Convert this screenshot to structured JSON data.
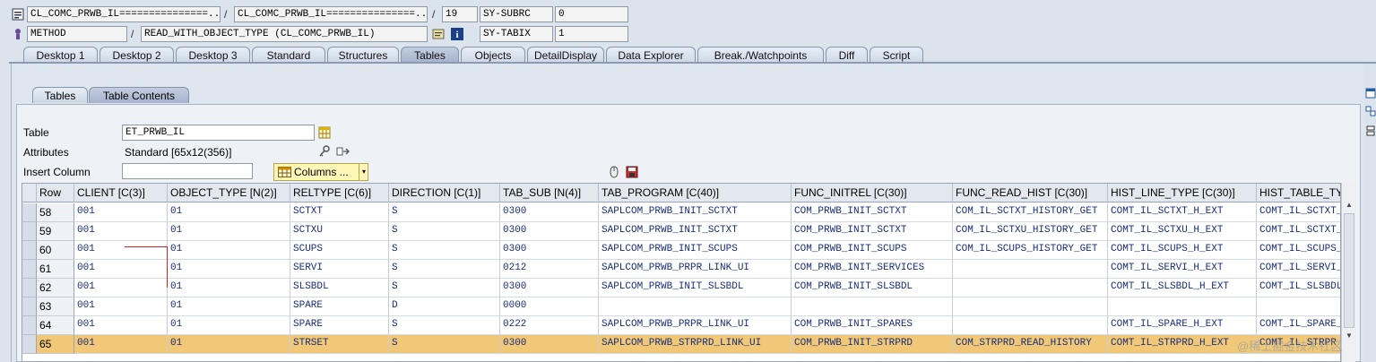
{
  "top": {
    "row1": {
      "class_field": "CL_COMC_PRWB_IL===============...",
      "sep1": "/",
      "include_field": "CL_COMC_PRWB_IL===============...",
      "sep2": "/",
      "line_field": "19",
      "sysvar_name": "SY-SUBRC",
      "sysvar_value": "0"
    },
    "row2": {
      "type_field": "METHOD",
      "sep1": "/",
      "method_field": "READ_WITH_OBJECT_TYPE (CL_COMC_PRWB_IL)",
      "sysvar_name": "SY-TABIX",
      "sysvar_value": "1"
    }
  },
  "tabs": [
    "Desktop 1",
    "Desktop 2",
    "Desktop 3",
    "Standard",
    "Structures",
    "Tables",
    "Objects",
    "DetailDisplay",
    "Data Explorer",
    "Break./Watchpoints",
    "Diff",
    "Script"
  ],
  "active_tab": "Tables",
  "inner_tabs": [
    "Tables",
    "Table Contents"
  ],
  "form": {
    "table_label": "Table",
    "table_value": "ET_PRWB_IL",
    "attributes_label": "Attributes",
    "attributes_value": "Standard [65x12(356)]",
    "insert_column_label": "Insert Column",
    "insert_column_value": "",
    "columns_button": "Columns ..."
  },
  "grid": {
    "headers": [
      "Row",
      "CLIENT [C(3)]",
      "OBJECT_TYPE [N(2)]",
      "RELTYPE [C(6)]",
      "DIRECTION [C(1)]",
      "TAB_SUB [N(4)]",
      "TAB_PROGRAM [C(40)]",
      "FUNC_INITREL [C(30)]",
      "FUNC_READ_HIST [C(30)]",
      "HIST_LINE_TYPE [C(30)]",
      "HIST_TABLE_TY"
    ],
    "rows": [
      [
        "58",
        "001",
        "01",
        "SCTXT",
        "S",
        "0300",
        "SAPLCOM_PRWB_INIT_SCTXT",
        "COM_PRWB_INIT_SCTXT",
        "COM_IL_SCTXT_HISTORY_GET",
        "COMT_IL_SCTXT_H_EXT",
        "COMT_IL_SCTXT_"
      ],
      [
        "59",
        "001",
        "01",
        "SCTXU",
        "S",
        "0300",
        "SAPLCOM_PRWB_INIT_SCTXT",
        "COM_PRWB_INIT_SCTXT",
        "COM_IL_SCTXU_HISTORY_GET",
        "COMT_IL_SCTXU_H_EXT",
        "COMT_IL_SCTXT_"
      ],
      [
        "60",
        "001",
        "01",
        "SCUPS",
        "S",
        "0300",
        "SAPLCOM_PRWB_INIT_SCUPS",
        "COM_PRWB_INIT_SCUPS",
        "COM_IL_SCUPS_HISTORY_GET",
        "COMT_IL_SCUPS_H_EXT",
        "COMT_IL_SCUPS_"
      ],
      [
        "61",
        "001",
        "01",
        "SERVI",
        "S",
        "0212",
        "SAPLCOM_PRWB_PRPR_LINK_UI",
        "COM_PRWB_INIT_SERVICES",
        "",
        "COMT_IL_SERVI_H_EXT",
        "COMT_IL_SERVI_"
      ],
      [
        "62",
        "001",
        "01",
        "SLSBDL",
        "S",
        "0300",
        "SAPLCOM_PRWB_INIT_SLSBDL",
        "COM_PRWB_INIT_SLSBDL",
        "",
        "COMT_IL_SLSBDL_H_EXT",
        "COMT_IL_SLSBDL"
      ],
      [
        "63",
        "001",
        "01",
        "SPARE",
        "D",
        "0000",
        "",
        "",
        "",
        "",
        ""
      ],
      [
        "64",
        "001",
        "01",
        "SPARE",
        "S",
        "0222",
        "SAPLCOM_PRWB_PRPR_LINK_UI",
        "COM_PRWB_INIT_SPARES",
        "",
        "COMT_IL_SPARE_H_EXT",
        "COMT_IL_SPARE_"
      ],
      [
        "65",
        "001",
        "01",
        "STRSET",
        "S",
        "0300",
        "SAPLCOM_PRWB_STRPRD_LINK_UI",
        "COM_PRWB_INIT_STRPRD",
        "COM_STRPRD_READ_HISTORY",
        "COMT_IL_STRPRD_H_EXT",
        "COMT_IL_STRPR"
      ]
    ],
    "highlighted_row": "65"
  },
  "colors": {
    "highlight_row": "#f0c878",
    "cell_text": "#1a2d7a",
    "columns_button_bg": "#fff7b8"
  },
  "watermark": "@稀土掘金技术社区"
}
